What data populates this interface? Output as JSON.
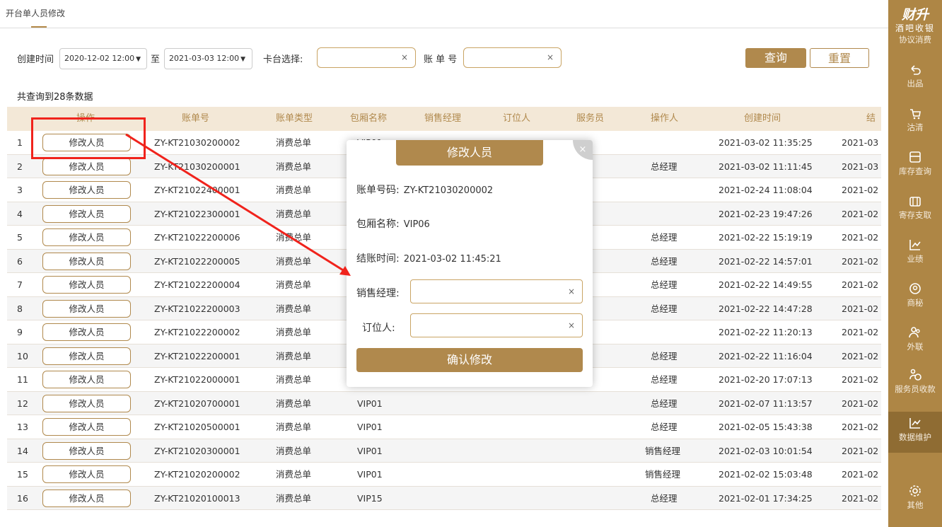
{
  "page": {
    "title": "开台单人员修改"
  },
  "filter": {
    "created_label": "创建时间",
    "date_from": "2020-12-02 12:00",
    "to_label": "至",
    "date_to": "2021-03-03 12:00",
    "table_label": "卡台选择:",
    "bill_label": "账 单 号",
    "clear_glyph": "×",
    "caret_glyph": "▼",
    "query_button": "查询",
    "reset_button": "重置"
  },
  "result_count": "共查询到28条数据",
  "table": {
    "columns": [
      "操作",
      "账单号",
      "账单类型",
      "包厢名称",
      "销售经理",
      "订位人",
      "服务员",
      "操作人",
      "创建时间",
      "结"
    ],
    "edit_label": "修改人员",
    "rows": [
      {
        "no": "1",
        "bill": "ZY-KT21030200002",
        "type": "消费总单",
        "room": "VIP01",
        "op": "",
        "created": "2021-03-02 11:35:25",
        "end": "2021-03"
      },
      {
        "no": "2",
        "bill": "ZY-KT21030200001",
        "type": "消费总单",
        "room": "",
        "op": "总经理",
        "created": "2021-03-02 11:11:45",
        "end": "2021-03"
      },
      {
        "no": "3",
        "bill": "ZY-KT21022400001",
        "type": "消费总单",
        "room": "",
        "op": "",
        "created": "2021-02-24 11:08:04",
        "end": "2021-02"
      },
      {
        "no": "4",
        "bill": "ZY-KT21022300001",
        "type": "消费总单",
        "room": "",
        "op": "",
        "created": "2021-02-23 19:47:26",
        "end": "2021-02"
      },
      {
        "no": "5",
        "bill": "ZY-KT21022200006",
        "type": "消费总单",
        "room": "",
        "op": "总经理",
        "created": "2021-02-22 15:19:19",
        "end": "2021-02"
      },
      {
        "no": "6",
        "bill": "ZY-KT21022200005",
        "type": "消费总单",
        "room": "",
        "op": "总经理",
        "created": "2021-02-22 14:57:01",
        "end": "2021-02"
      },
      {
        "no": "7",
        "bill": "ZY-KT21022200004",
        "type": "消费总单",
        "room": "",
        "op": "总经理",
        "created": "2021-02-22 14:49:55",
        "end": "2021-02"
      },
      {
        "no": "8",
        "bill": "ZY-KT21022200003",
        "type": "消费总单",
        "room": "",
        "op": "总经理",
        "created": "2021-02-22 14:47:28",
        "end": "2021-02"
      },
      {
        "no": "9",
        "bill": "ZY-KT21022200002",
        "type": "消费总单",
        "room": "",
        "op": "",
        "created": "2021-02-22 11:20:13",
        "end": "2021-02"
      },
      {
        "no": "10",
        "bill": "ZY-KT21022200001",
        "type": "消费总单",
        "room": "",
        "op": "总经理",
        "created": "2021-02-22 11:16:04",
        "end": "2021-02"
      },
      {
        "no": "11",
        "bill": "ZY-KT21022000001",
        "type": "消费总单",
        "room": "",
        "op": "总经理",
        "created": "2021-02-20 17:07:13",
        "end": "2021-02"
      },
      {
        "no": "12",
        "bill": "ZY-KT21020700001",
        "type": "消费总单",
        "room": "VIP01",
        "op": "总经理",
        "created": "2021-02-07 11:13:57",
        "end": "2021-02"
      },
      {
        "no": "13",
        "bill": "ZY-KT21020500001",
        "type": "消费总单",
        "room": "VIP01",
        "op": "总经理",
        "created": "2021-02-05 15:43:38",
        "end": "2021-02"
      },
      {
        "no": "14",
        "bill": "ZY-KT21020300001",
        "type": "消费总单",
        "room": "VIP01",
        "op": "销售经理",
        "created": "2021-02-03 10:01:54",
        "end": "2021-02"
      },
      {
        "no": "15",
        "bill": "ZY-KT21020200002",
        "type": "消费总单",
        "room": "VIP01",
        "op": "销售经理",
        "created": "2021-02-02 15:03:48",
        "end": "2021-02"
      },
      {
        "no": "16",
        "bill": "ZY-KT21020100013",
        "type": "消费总单",
        "room": "VIP15",
        "op": "总经理",
        "created": "2021-02-01 17:34:25",
        "end": "2021-02"
      }
    ]
  },
  "sidebar": {
    "brand_title": "财升",
    "brand_subtitle": "酒吧收银",
    "items": [
      {
        "label": "协议消费",
        "icon": "agreement-icon"
      },
      {
        "label": "出品",
        "icon": "return-icon"
      },
      {
        "label": "沽清",
        "icon": "cart-icon"
      },
      {
        "label": "库存查询",
        "icon": "inventory-icon"
      },
      {
        "label": "寄存支取",
        "icon": "deposit-icon"
      },
      {
        "label": "业绩",
        "icon": "chart-icon"
      },
      {
        "label": "商秘",
        "icon": "secretary-icon"
      },
      {
        "label": "外联",
        "icon": "people-icon"
      },
      {
        "label": "服务员收款",
        "icon": "waiter-payment-icon"
      },
      {
        "label": "数据维护",
        "icon": "data-maintenance-icon"
      },
      {
        "label": "其他",
        "icon": "gear-icon"
      }
    ],
    "active_index": 9
  },
  "modal": {
    "title": "修改人员",
    "close_glyph": "×",
    "bill_label": "账单号码:",
    "bill_value": "ZY-KT21030200002",
    "room_label": "包厢名称:",
    "room_value": "VIP06",
    "checkout_label": "结账时间:",
    "checkout_value": "2021-03-02 11:45:21",
    "sales_label": "销售经理:",
    "booker_label": "订位人:",
    "confirm_button": "确认修改"
  },
  "colors": {
    "accent": "#b0894d",
    "sidebar": "#ae8645",
    "header_bg": "#f3e8d7",
    "annotation": "#f0231c"
  }
}
